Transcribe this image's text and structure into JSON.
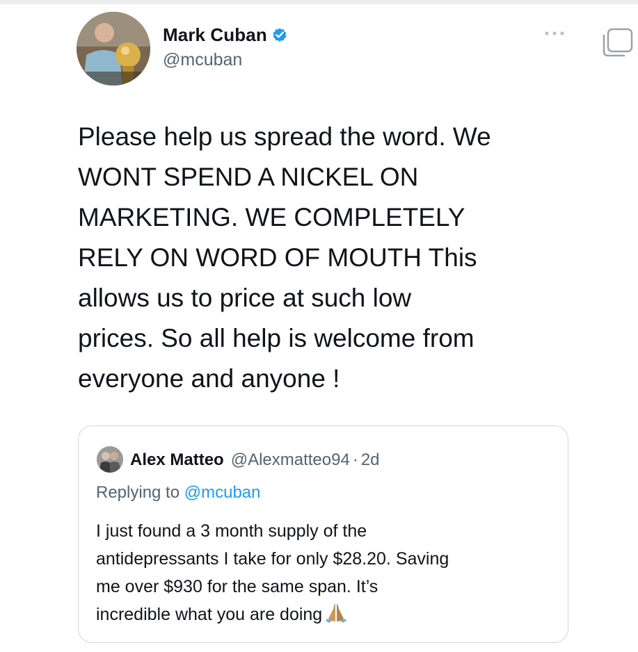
{
  "tweet": {
    "author": {
      "display_name": "Mark Cuban",
      "handle": "@mcuban",
      "verified": true,
      "avatar_icon": "profile-photo"
    },
    "text": "Please help us spread the word.  We\nWONT SPEND A NICKEL ON\nMARKETING. WE COMPLETELY\nRELY ON WORD OF MOUTH  This\nallows us to price at such  low\nprices.  So all help is welcome from\neveryone and anyone !",
    "more_icon": "ellipsis-icon",
    "verified_color": "#1d9bf0"
  },
  "quoted_tweet": {
    "author": {
      "display_name": "Alex Matteo",
      "handle": "@Alexmatteo94",
      "separator": "·",
      "time": "2d"
    },
    "replying_prefix": "Replying to ",
    "replying_to": "@mcuban",
    "text": "I just found a 3 month supply of the\nantidepressants I take for only $28.20. Saving\nme over $930 for the same span. It’s\nincredible what you are doing",
    "emoji": "folded-hands"
  },
  "colors": {
    "text_primary": "#0f1419",
    "text_secondary": "#536471",
    "link": "#1d9bf0",
    "border": "#cfd9de"
  }
}
